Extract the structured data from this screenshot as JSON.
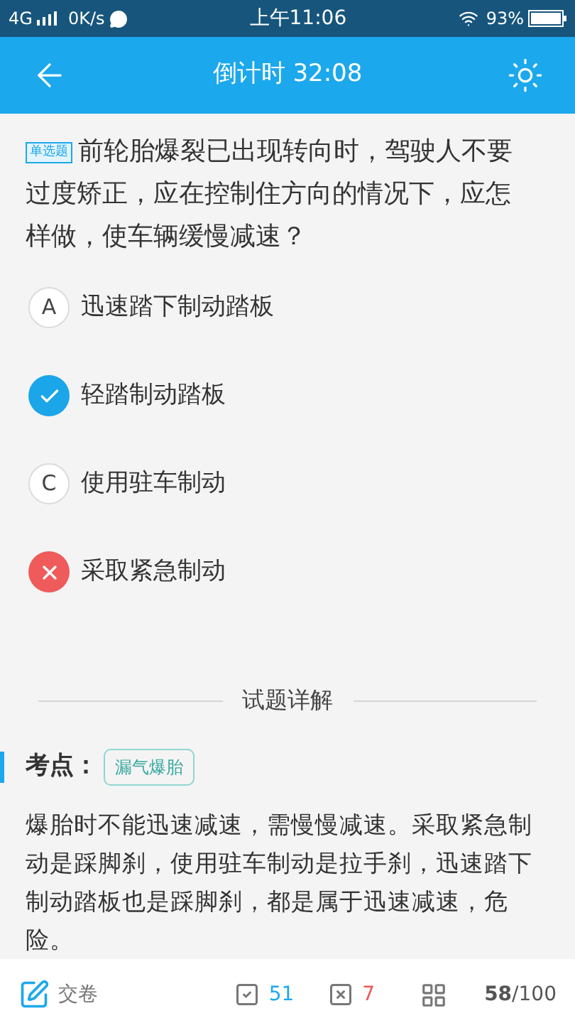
{
  "status_bar": {
    "network": "4G",
    "speed": "0K/s",
    "time": "上午11:06",
    "battery": "93%"
  },
  "header": {
    "title": "倒计时 32:08"
  },
  "question": {
    "badge": "单选题",
    "text": "前轮胎爆裂已出现转向时，驾驶人不要过度矫正，应在控制住方向的情况下，应怎样做，使车辆缓慢减速？"
  },
  "options": [
    {
      "kind": "letter",
      "letter": "A",
      "text": "迅速踏下制动踏板"
    },
    {
      "kind": "correct",
      "text": "轻踏制动踏板"
    },
    {
      "kind": "letter",
      "letter": "C",
      "text": "使用驻车制动"
    },
    {
      "kind": "wrong",
      "text": "采取紧急制动"
    }
  ],
  "explanation": {
    "heading": "试题详解",
    "point_label": "考点：",
    "point_tag": "漏气爆胎",
    "text": "爆胎时不能迅速减速，需慢慢减速。采取紧急制动是踩脚刹，使用驻车制动是拉手刹，迅速踏下制动踏板也是踩脚刹，都是属于迅速减速，危险。"
  },
  "bottom_bar": {
    "submit": "交卷",
    "correct_count": "51",
    "wrong_count": "7",
    "progress": "**58**/100"
  }
}
